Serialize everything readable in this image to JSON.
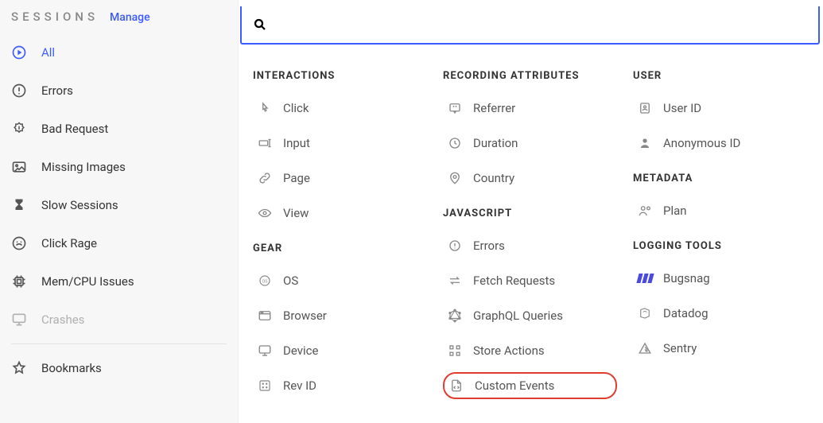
{
  "sidebar": {
    "title": "SESSIONS",
    "manage": "Manage",
    "items": [
      {
        "label": "All"
      },
      {
        "label": "Errors"
      },
      {
        "label": "Bad Request"
      },
      {
        "label": "Missing Images"
      },
      {
        "label": "Slow Sessions"
      },
      {
        "label": "Click Rage"
      },
      {
        "label": "Mem/CPU Issues"
      },
      {
        "label": "Crashes"
      }
    ],
    "bookmarks": "Bookmarks"
  },
  "search": {
    "value": "",
    "placeholder": ""
  },
  "groups": {
    "interactions": {
      "title": "INTERACTIONS",
      "items": [
        "Click",
        "Input",
        "Page",
        "View"
      ]
    },
    "gear": {
      "title": "GEAR",
      "items": [
        "OS",
        "Browser",
        "Device",
        "Rev ID"
      ]
    },
    "recording": {
      "title": "RECORDING ATTRIBUTES",
      "items": [
        "Referrer",
        "Duration",
        "Country"
      ]
    },
    "javascript": {
      "title": "JAVASCRIPT",
      "items": [
        "Errors",
        "Fetch Requests",
        "GraphQL Queries",
        "Store Actions",
        "Custom Events"
      ]
    },
    "user": {
      "title": "USER",
      "items": [
        "User ID",
        "Anonymous ID"
      ]
    },
    "metadata": {
      "title": "METADATA",
      "items": [
        "Plan"
      ]
    },
    "logging": {
      "title": "LOGGING TOOLS",
      "items": [
        "Bugsnag",
        "Datadog",
        "Sentry"
      ]
    }
  }
}
